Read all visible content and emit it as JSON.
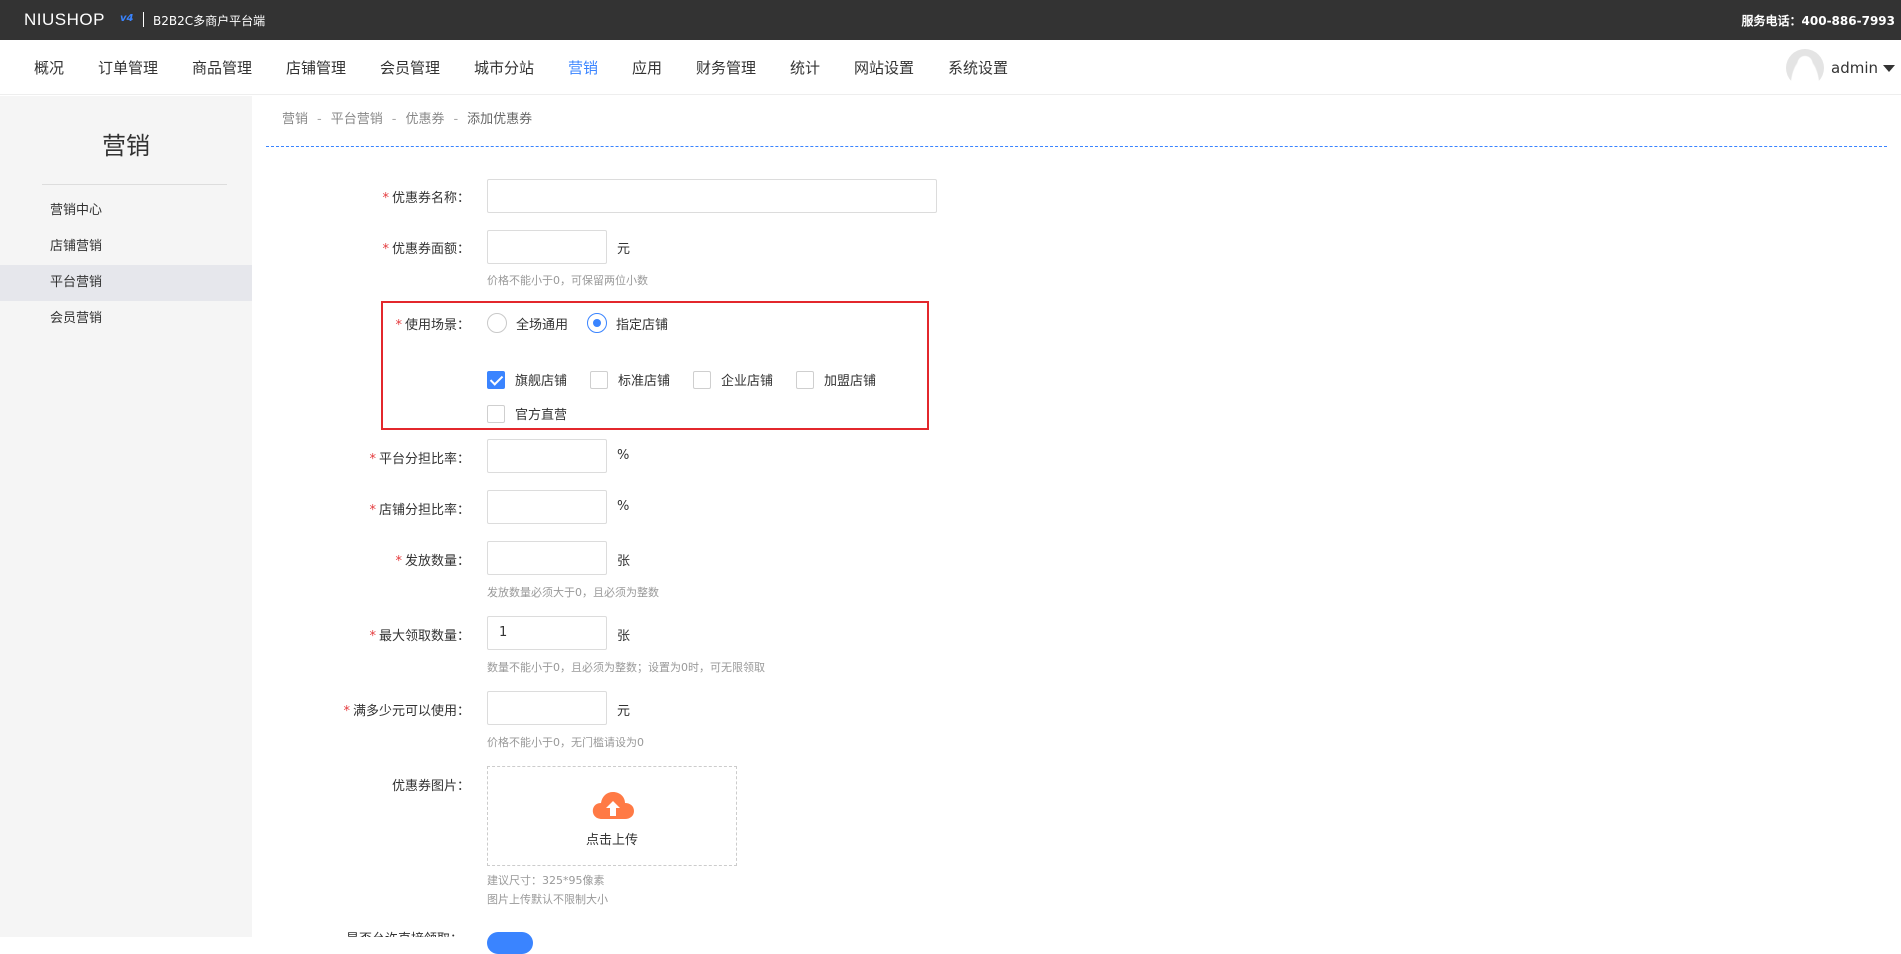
{
  "header": {
    "logo_text": "NIUSHOP",
    "logo_version": "v4",
    "platform_name": "B2B2C多商户平台端",
    "hotline": "服务电话：400-886-7993"
  },
  "nav": {
    "items": [
      "概况",
      "订单管理",
      "商品管理",
      "店铺管理",
      "会员管理",
      "城市分站",
      "营销",
      "应用",
      "财务管理",
      "统计",
      "网站设置",
      "系统设置"
    ],
    "active": "营销",
    "user_name": "admin"
  },
  "sidebar": {
    "title": "营销",
    "items": [
      "营销中心",
      "店铺营销",
      "平台营销",
      "会员营销"
    ],
    "active": "平台营销"
  },
  "breadcrumb": [
    "营销",
    "平台营销",
    "优惠券",
    "添加优惠券"
  ],
  "form": {
    "coupon_name": {
      "label": "优惠券名称：",
      "value": ""
    },
    "face_value": {
      "label": "优惠券面额：",
      "value": "",
      "unit": "元",
      "hint": "价格不能小于0，可保留两位小数"
    },
    "scene": {
      "label": "使用场景：",
      "options": [
        "全场通用",
        "指定店铺"
      ],
      "selected": "指定店铺",
      "store_types": [
        {
          "label": "旗舰店铺",
          "checked": true
        },
        {
          "label": "标准店铺",
          "checked": false
        },
        {
          "label": "企业店铺",
          "checked": false
        },
        {
          "label": "加盟店铺",
          "checked": false
        },
        {
          "label": "官方直营",
          "checked": false
        }
      ]
    },
    "platform_share": {
      "label": "平台分担比率：",
      "value": "",
      "unit": "%"
    },
    "store_share": {
      "label": "店铺分担比率：",
      "value": "",
      "unit": "%"
    },
    "issue_count": {
      "label": "发放数量：",
      "value": "",
      "unit": "张",
      "hint": "发放数量必须大于0，且必须为整数"
    },
    "max_claim": {
      "label": "最大领取数量：",
      "value": "1",
      "unit": "张",
      "hint": "数量不能小于0，且必须为整数；设置为0时，可无限领取"
    },
    "min_spend": {
      "label": "满多少元可以使用：",
      "value": "",
      "unit": "元",
      "hint": "价格不能小于0，无门槛请设为0"
    },
    "image": {
      "label": "优惠券图片：",
      "upload_text": "点击上传",
      "hint_size": "建议尺寸：325*95像素",
      "hint_limit": "图片上传默认不限制大小"
    },
    "partial_label": "是否允许直接领取："
  },
  "colors": {
    "accent": "#3a84ff",
    "topbar": "#333333",
    "highlight": "#e3272c",
    "upload_icon": "#ff7a45"
  }
}
